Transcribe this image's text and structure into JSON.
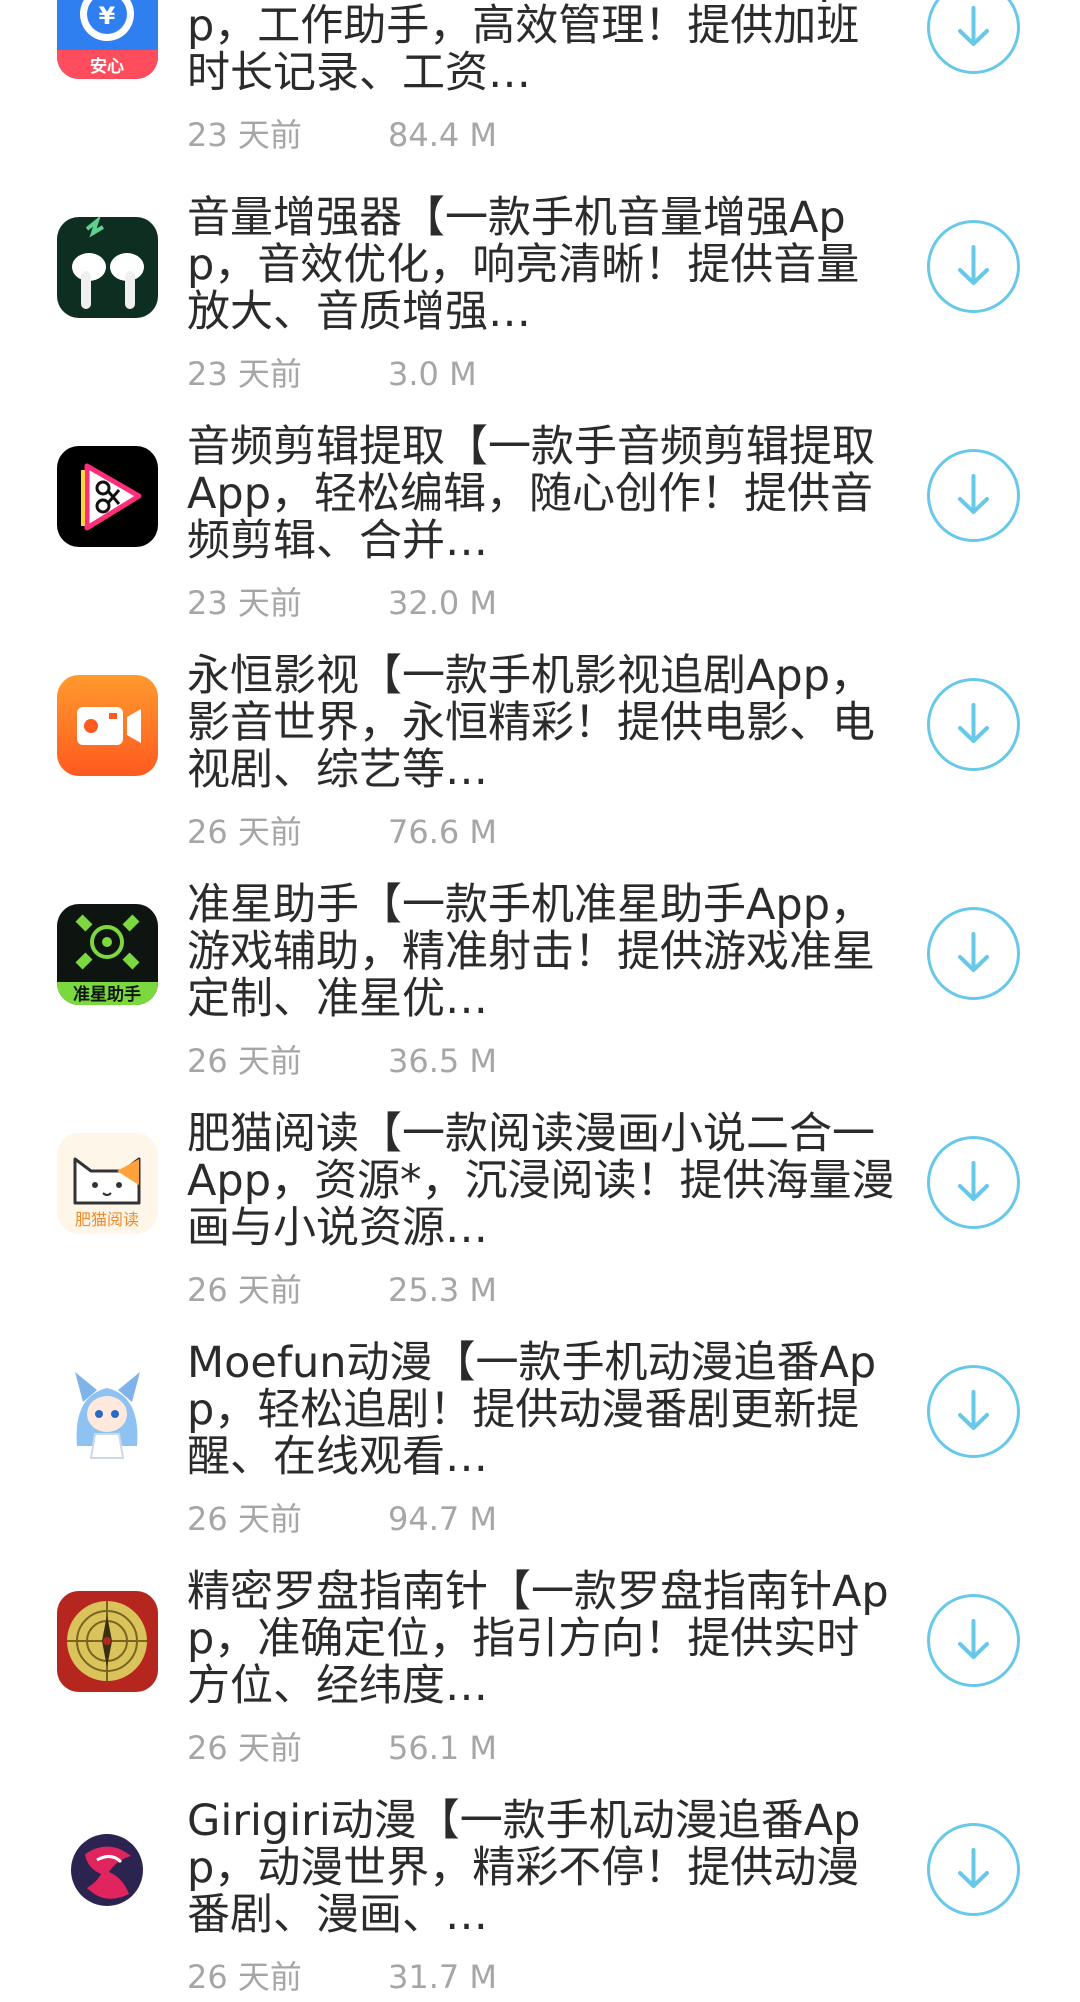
{
  "apps": [
    {
      "desc": "安心记加班【一款手机加班记录App，工作助手，高效管理！提供加班时长记录、工资…",
      "date": "23 天前",
      "size": "84.4 M",
      "icon": "clock-yen-icon",
      "icon_text": "安心"
    },
    {
      "desc": "音量增强器【一款手机音量增强App，音效优化，响亮清晰！提供音量放大、音质增强…",
      "date": "23 天前",
      "size": "3.0 M",
      "icon": "earbuds-icon"
    },
    {
      "desc": "音频剪辑提取【一款手音频剪辑提取App，轻松编辑，随心创作！提供音频剪辑、合并…",
      "date": "23 天前",
      "size": "32.0 M",
      "icon": "scissors-play-icon"
    },
    {
      "desc": "永恒影视【一款手机影视追剧App，影音世界，永恒精彩！提供电影、电视剧、综艺等…",
      "date": "26 天前",
      "size": "76.6 M",
      "icon": "video-camera-icon"
    },
    {
      "desc": "准星助手【一款手机准星助手App，游戏辅助，精准射击！提供游戏准星定制、准星优…",
      "date": "26 天前",
      "size": "36.5 M",
      "icon": "crosshair-icon",
      "icon_text": "准星助手"
    },
    {
      "desc": "肥猫阅读【一款阅读漫画小说二合一App，资源*，沉浸阅读！提供海量漫画与小说资源…",
      "date": "26 天前",
      "size": "25.3 M",
      "icon": "fat-cat-icon",
      "icon_text": "肥猫阅读"
    },
    {
      "desc": "Moefun动漫【一款手机动漫追番App，轻松追剧！提供动漫番剧更新提醒、在线观看…",
      "date": "26 天前",
      "size": "94.7 M",
      "icon": "anime-girl-icon"
    },
    {
      "desc": "精密罗盘指南针【一款罗盘指南针App，准确定位，指引方向！提供实时方位、经纬度…",
      "date": "26 天前",
      "size": "56.1 M",
      "icon": "compass-icon"
    },
    {
      "desc": "Girigiri动漫【一款手机动漫追番App，动漫世界，精彩不停！提供动漫番剧、漫画、…",
      "date": "26 天前",
      "size": "31.7 M",
      "icon": "girigiri-logo-icon"
    }
  ],
  "colors": {
    "accent": "#67c8ea",
    "title_text": "#2b2b2b",
    "meta_text": "#a6a6a6"
  },
  "download_icon": "download-arrow-icon"
}
